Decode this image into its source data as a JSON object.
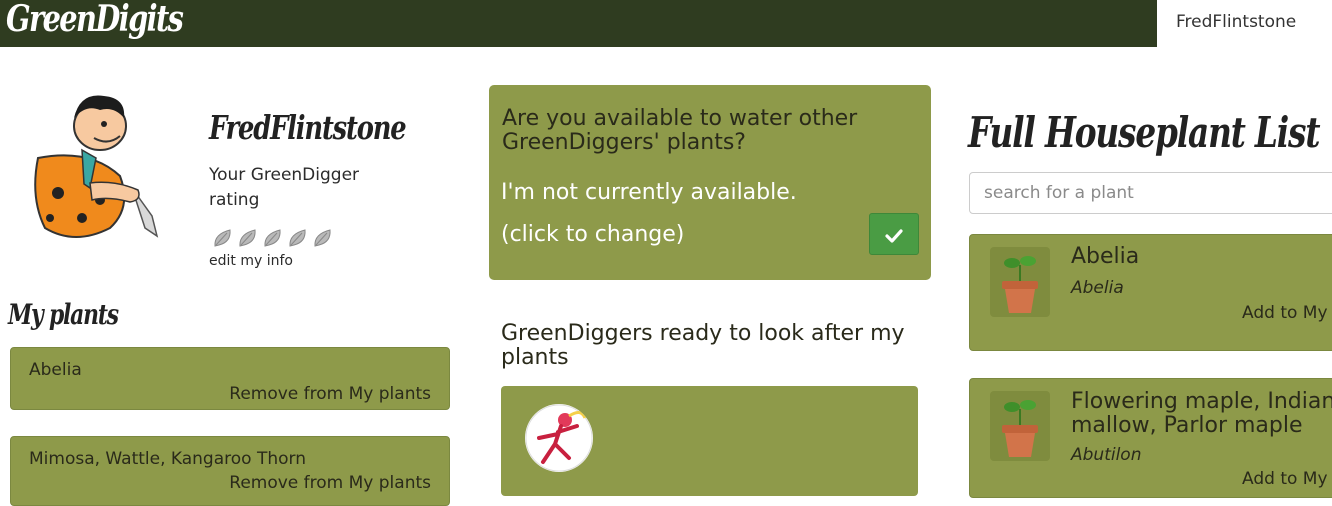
{
  "navbar": {
    "brand": "GreenDigits",
    "user_link": "FredFlintstone"
  },
  "profile": {
    "name": "FredFlintstone",
    "rating_label": "Your GreenDigger rating",
    "rating_leaves": 5,
    "edit_link": "edit my info"
  },
  "my_plants": {
    "title": "My plants",
    "items": [
      {
        "name": "Abelia",
        "action": "Remove from My plants"
      },
      {
        "name": "Mimosa, Wattle, Kangaroo Thorn",
        "action": "Remove from My plants"
      }
    ]
  },
  "availability": {
    "question": "Are you available to water other GreenDiggers' plants?",
    "status": "I'm not currently available. (click to change)",
    "button_icon": "check-icon"
  },
  "ready": {
    "title": "GreenDiggers ready to look after my plants"
  },
  "houseplants": {
    "title": "Full Houseplant List",
    "search_placeholder": "search for a plant",
    "items": [
      {
        "common": "Abelia",
        "latin": "Abelia",
        "action": "Add to My plants"
      },
      {
        "common": "Flowering maple, Indian mallow, Parlor maple",
        "latin": "Abutilon",
        "action": "Add to My plants"
      }
    ]
  },
  "colors": {
    "navbar": "#2f3c20",
    "card": "#8e9a4a",
    "button": "#4a9c44"
  }
}
